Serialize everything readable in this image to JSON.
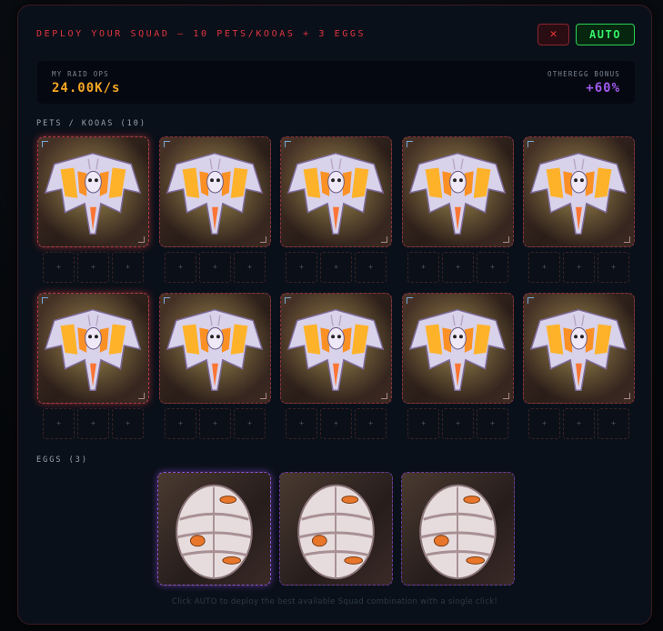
{
  "header": {
    "title": "DEPLOY YOUR SQUAD — 10 PETS/KOOAS + 3 EGGS",
    "close_label": "✕",
    "auto_label": "AUTO"
  },
  "stats": {
    "raid_ops_label": "MY RAID OPS",
    "raid_ops_value": "24.00K/s",
    "raid_ops_color": "#f5a623",
    "bonus_label": "OTHEREGG BONUS",
    "bonus_value": "+60%",
    "bonus_color": "#a05af0"
  },
  "pets_section": {
    "label": "PETS / KOOAS (10)",
    "pets": [
      {
        "icon": "bat-dragon-pet",
        "slots": [
          "+",
          "+",
          "+"
        ]
      },
      {
        "icon": "bat-dragon-pet",
        "slots": [
          "+",
          "+",
          "+"
        ]
      },
      {
        "icon": "bat-dragon-pet",
        "slots": [
          "+",
          "+",
          "+"
        ]
      },
      {
        "icon": "bat-dragon-pet",
        "slots": [
          "+",
          "+",
          "+"
        ]
      },
      {
        "icon": "bat-dragon-pet",
        "slots": [
          "+",
          "+",
          "+"
        ]
      },
      {
        "icon": "bat-dragon-pet",
        "slots": [
          "+",
          "+",
          "+"
        ]
      },
      {
        "icon": "bat-dragon-pet",
        "slots": [
          "+",
          "+",
          "+"
        ]
      },
      {
        "icon": "bat-dragon-pet",
        "slots": [
          "+",
          "+",
          "+"
        ]
      },
      {
        "icon": "bat-dragon-pet",
        "slots": [
          "+",
          "+",
          "+"
        ]
      },
      {
        "icon": "bat-dragon-pet",
        "slots": [
          "+",
          "+",
          "+"
        ]
      }
    ]
  },
  "eggs_section": {
    "label": "EGGS (3)",
    "eggs": [
      {
        "icon": "armored-egg"
      },
      {
        "icon": "armored-egg"
      },
      {
        "icon": "armored-egg"
      }
    ]
  },
  "footer": {
    "hint": "Click AUTO to deploy the best available Squad combination with a single click!"
  }
}
